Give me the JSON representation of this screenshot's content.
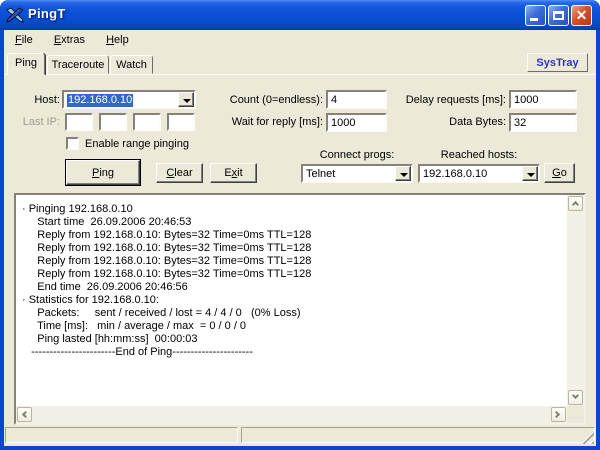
{
  "window": {
    "title": "PingT"
  },
  "icons": {
    "app_icon": "crossed-darts",
    "minimize_icon": "minimize",
    "maximize_icon": "maximize",
    "close_icon": "close",
    "dropdown_icon": "triangle-down",
    "scroll_icons": [
      "chevron-up",
      "chevron-down",
      "chevron-left",
      "chevron-right"
    ]
  },
  "menu": {
    "items": [
      {
        "label": "File",
        "accel": 0
      },
      {
        "label": "Extras",
        "accel": 0
      },
      {
        "label": "Help",
        "accel": 0
      }
    ]
  },
  "tabs": {
    "items": [
      "Ping",
      "Traceroute",
      "Watch"
    ],
    "active": "Ping",
    "systray_button": "SysTray"
  },
  "form": {
    "host": {
      "label": "Host:",
      "value": "192.168.0.10"
    },
    "last_ip": {
      "label": "Last IP:",
      "octets": [
        "",
        "",
        "",
        ""
      ]
    },
    "range_pinging": {
      "label": "Enable range pinging",
      "checked": false
    },
    "count": {
      "label": "Count (0=endless):",
      "value": "4"
    },
    "wait_reply": {
      "label": "Wait for reply [ms]:",
      "value": "1000"
    },
    "delay_requests": {
      "label": "Delay requests [ms]:",
      "value": "1000"
    },
    "data_bytes": {
      "label": "Data Bytes:",
      "value": "32"
    },
    "ping_button": {
      "label": "Ping",
      "accel": 0
    },
    "clear_button": {
      "label": "Clear",
      "accel": 0
    },
    "exit_button": {
      "label": "Exit",
      "accel": 1
    },
    "connect_progs": {
      "label": "Connect progs:",
      "value": "Telnet"
    },
    "reached_hosts": {
      "label": "Reached hosts:",
      "value": "192.168.0.10"
    },
    "go_button": {
      "label": "Go",
      "accel": 0
    }
  },
  "output": {
    "lines": [
      "· Pinging 192.168.0.10",
      "     Start time  26.09.2006 20:46:53",
      "     Reply from 192.168.0.10: Bytes=32 Time=0ms TTL=128",
      "     Reply from 192.168.0.10: Bytes=32 Time=0ms TTL=128",
      "     Reply from 192.168.0.10: Bytes=32 Time=0ms TTL=128",
      "     Reply from 192.168.0.10: Bytes=32 Time=0ms TTL=128",
      "     End time  26.09.2006 20:46:56",
      "· Statistics for 192.168.0.10:",
      "     Packets:     sent / received / lost = 4 / 4 / 0   (0% Loss)",
      "     Time [ms]:   min / average / max  = 0 / 0 / 0",
      "     Ping lasted [hh:mm:ss]  00:00:03",
      "   -----------------------End of Ping----------------------"
    ]
  },
  "colors": {
    "titlebar_blue": "#0b50d6",
    "window_border_blue": "#0a46cf",
    "chrome_beige": "#ece9d8",
    "selection_blue": "#316ac5",
    "systray_text_blue": "#2b35c8",
    "close_button_red": "#d8502a"
  }
}
